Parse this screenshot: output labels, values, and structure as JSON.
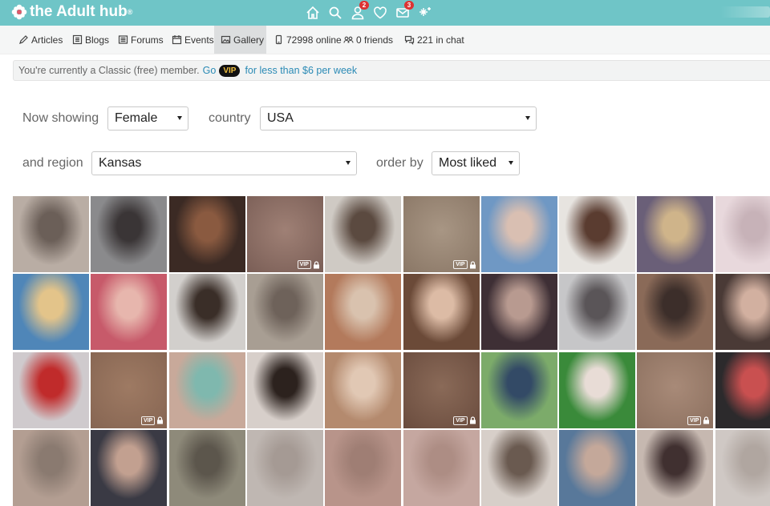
{
  "brand": {
    "name": "the Adult hub",
    "trademark": "®"
  },
  "top_icons": [
    {
      "name": "home-icon",
      "badge": ""
    },
    {
      "name": "search-icon",
      "badge": ""
    },
    {
      "name": "user-icon",
      "badge": "2"
    },
    {
      "name": "heart-icon",
      "badge": ""
    },
    {
      "name": "mail-icon",
      "badge": "3"
    },
    {
      "name": "sparkle-icon",
      "badge": ""
    }
  ],
  "subnav": {
    "articles": "Articles",
    "blogs": "Blogs",
    "forums": "Forums",
    "events": "Events",
    "gallery": "Gallery",
    "online": "72998 online",
    "friends": "0 friends",
    "chat": "221 in chat"
  },
  "notice": {
    "text": "You're currently a Classic (free) member.",
    "go": "Go",
    "vip": "VIP",
    "rest": "for less than $6 per week"
  },
  "filters": {
    "now_showing_label": "Now showing",
    "gender": "Female",
    "country_label": "country",
    "country": "USA",
    "region_label": "and region",
    "region": "Kansas",
    "order_label": "order by",
    "order": "Most liked"
  },
  "gallery": {
    "vip_label": "VIP",
    "rows": [
      [
        {
          "c1": "#b9ada4",
          "c2": "#6b5f58",
          "vip": false
        },
        {
          "c1": "#8a8a8c",
          "c2": "#3a3536",
          "vip": false
        },
        {
          "c1": "#3b2a24",
          "c2": "#8a5a40",
          "vip": false
        },
        {
          "c1": "#9f8075",
          "c2": "#7a5e56",
          "vip": true
        },
        {
          "c1": "#cfcac4",
          "c2": "#5b4a40",
          "vip": false
        },
        {
          "c1": "#a89684",
          "c2": "#8a7766",
          "vip": true
        },
        {
          "c1": "#6f98c4",
          "c2": "#d9bfb2",
          "vip": false
        },
        {
          "c1": "#e7e4e0",
          "c2": "#5a3c30",
          "vip": false
        },
        {
          "c1": "#6a5f78",
          "c2": "#cfb48a",
          "vip": false
        },
        {
          "c1": "#e8d8dc",
          "c2": "#c7b2b8",
          "vip": false
        }
      ],
      [
        {
          "c1": "#4f86b8",
          "c2": "#e3c48a",
          "vip": false
        },
        {
          "c1": "#c75a6a",
          "c2": "#e7b6ad",
          "vip": false
        },
        {
          "c1": "#d2cfcc",
          "c2": "#3a2e28",
          "vip": false
        },
        {
          "c1": "#a89e93",
          "c2": "#6e625a",
          "vip": false
        },
        {
          "c1": "#b37a5c",
          "c2": "#d9c2ae",
          "vip": false
        },
        {
          "c1": "#6b4a38",
          "c2": "#dcbba5",
          "vip": false
        },
        {
          "c1": "#3e2f35",
          "c2": "#b89a90",
          "vip": false
        },
        {
          "c1": "#c6c6c8",
          "c2": "#5a5558",
          "vip": false
        },
        {
          "c1": "#8a6a58",
          "c2": "#3c2e2a",
          "vip": false
        },
        {
          "c1": "#4a3a36",
          "c2": "#d2b0a0",
          "vip": false
        }
      ],
      [
        {
          "c1": "#cfcacd",
          "c2": "#c02b2b",
          "vip": false
        },
        {
          "c1": "#9e7a63",
          "c2": "#866552",
          "vip": true
        },
        {
          "c1": "#c8a99a",
          "c2": "#7fb8ae",
          "vip": false
        },
        {
          "c1": "#d7cfca",
          "c2": "#2c221e",
          "vip": false
        },
        {
          "c1": "#b48a6e",
          "c2": "#e1c8b4",
          "vip": false
        },
        {
          "c1": "#8a6a58",
          "c2": "#6a4c3e",
          "vip": true
        },
        {
          "c1": "#7cab6a",
          "c2": "#334a66",
          "vip": false
        },
        {
          "c1": "#3a8a3a",
          "c2": "#e8dcd6",
          "vip": false
        },
        {
          "c1": "#a88a78",
          "c2": "#8c705f",
          "vip": true
        },
        {
          "c1": "#2c2a2c",
          "c2": "#c95050",
          "vip": false
        }
      ],
      [
        {
          "c1": "#b39e92",
          "c2": "#8a7a70",
          "vip": false
        },
        {
          "c1": "#3a3a44",
          "c2": "#c2a090",
          "vip": false
        },
        {
          "c1": "#8e8a7a",
          "c2": "#5c564c",
          "vip": false
        },
        {
          "c1": "#bfb7b2",
          "c2": "#a59a94",
          "vip": false
        },
        {
          "c1": "#b8948a",
          "c2": "#9f7e74",
          "vip": false
        },
        {
          "c1": "#c5a7a0",
          "c2": "#ad8d84",
          "vip": false
        },
        {
          "c1": "#d7cfc9",
          "c2": "#6a5a50",
          "vip": false
        },
        {
          "c1": "#58789a",
          "c2": "#c4a89a",
          "vip": false
        },
        {
          "c1": "#c6b8b0",
          "c2": "#403030",
          "vip": false
        },
        {
          "c1": "#cfc8c4",
          "c2": "#b0a6a0",
          "vip": false
        }
      ]
    ]
  }
}
